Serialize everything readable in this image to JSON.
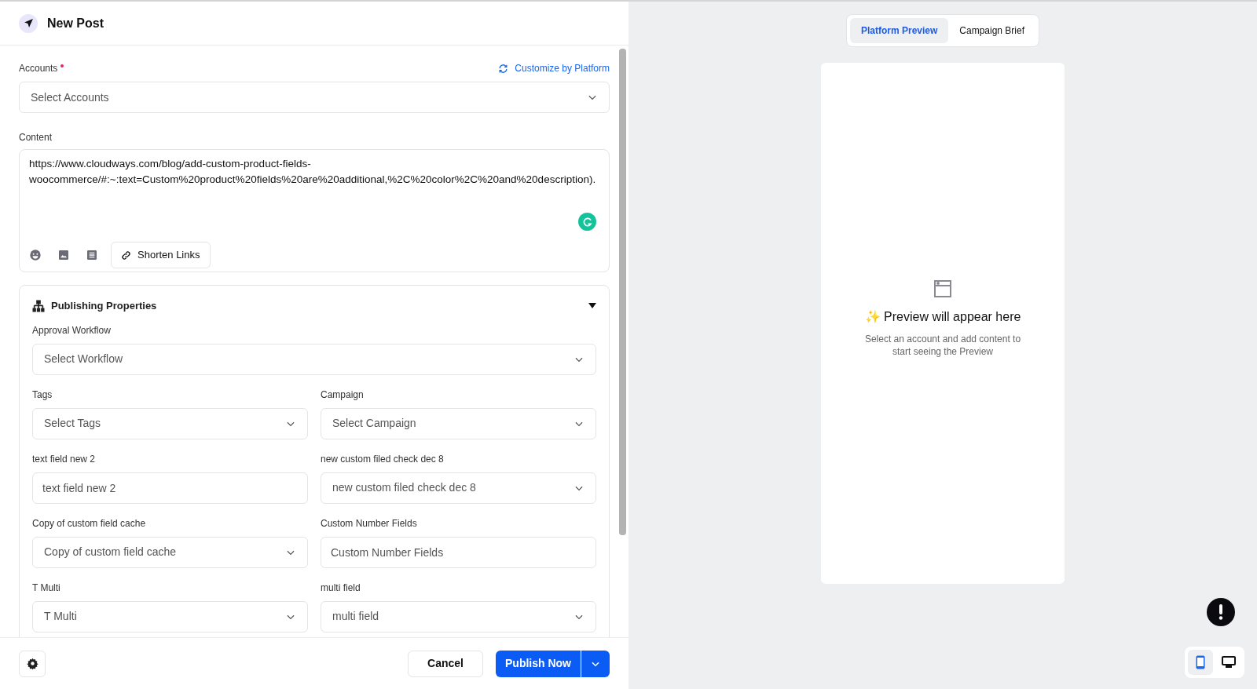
{
  "header": {
    "title": "New Post"
  },
  "accounts": {
    "label": "Accounts",
    "required": true,
    "customize_link": "Customize by Platform",
    "placeholder": "Select Accounts"
  },
  "content": {
    "label": "Content",
    "value": "https://www.cloudways.com/blog/add-custom-product-fields-woocommerce/#:~:text=Custom%20product%20fields%20are%20additional,%2C%20color%2C%20and%20description).",
    "shorten_button": "Shorten Links"
  },
  "publishing_properties": {
    "title": "Publishing Properties",
    "expanded": true,
    "approval_workflow": {
      "label": "Approval Workflow",
      "kind": "select",
      "placeholder": "Select Workflow"
    },
    "fields": [
      {
        "label": "Tags",
        "kind": "select",
        "placeholder": "Select Tags"
      },
      {
        "label": "Campaign",
        "kind": "select",
        "placeholder": "Select Campaign"
      },
      {
        "label": "text field new 2",
        "kind": "text",
        "placeholder": "text field new 2"
      },
      {
        "label": "new custom filed check dec 8",
        "kind": "select",
        "placeholder": "new custom filed check dec 8"
      },
      {
        "label": "Copy of custom field cache",
        "kind": "select",
        "placeholder": "Copy of custom field cache"
      },
      {
        "label": "Custom Number Fields",
        "kind": "text",
        "placeholder": "Custom Number Fields"
      },
      {
        "label": "T Multi",
        "kind": "select",
        "placeholder": "T Multi"
      },
      {
        "label": "multi field",
        "kind": "select",
        "placeholder": "multi field"
      }
    ]
  },
  "footer": {
    "cancel": "Cancel",
    "publish": "Publish Now"
  },
  "preview_tabs": [
    {
      "label": "Platform Preview",
      "selected": true
    },
    {
      "label": "Campaign Brief",
      "selected": false
    }
  ],
  "preview": {
    "title": "✨ Preview will appear here",
    "subtitle": "Select an account and add content to start seeing the Preview"
  },
  "device_toggle": [
    {
      "kind": "mobile",
      "selected": true
    },
    {
      "kind": "desktop",
      "selected": false
    }
  ]
}
